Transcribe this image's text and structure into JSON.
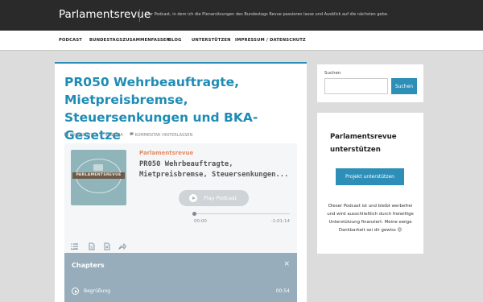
{
  "site": {
    "title": "Parlamentsrevue",
    "description": "Der Podcast, in dem ich die Plenarsitzungen des Bundestags Revue passieren lasse und Ausblick auf die nächsten gebe."
  },
  "nav": {
    "items": [
      {
        "label": "PODCAST"
      },
      {
        "label": "BUNDESTAGSZUSAMMENFASSER"
      },
      {
        "label": "BLOG"
      },
      {
        "label": "UNTERSTÜTZEN"
      },
      {
        "label": "IMPRESSUM / DATENSCHUTZ"
      }
    ]
  },
  "post": {
    "title": "PR050 Wehrbeauftragte, Mietpreisbremse, Steuersenkungen und BKA-Gesetze",
    "date": "2025-06-09",
    "author": "SABRINA",
    "comment": "KOMMENTAR HINTERLASSEN"
  },
  "player": {
    "cover_text": "PARLAMENTSREVUE",
    "show": "Parlamentsrevue",
    "episode_title": "PR050 Wehrbeauftragte, Mietpreisbremse, Steuersenkungen...",
    "play_label": "Play Podcast",
    "time_current": "00:00",
    "time_remaining": "-1:01:14",
    "progress": 0,
    "chapters_title": "Chapters",
    "close_symbol": "×",
    "chapters": [
      {
        "title": "Begrüßung",
        "time": "00:54"
      },
      {
        "title": "",
        "time": ""
      }
    ]
  },
  "sidebar": {
    "search": {
      "label": "Suchen",
      "placeholder": "",
      "button": "Suchen"
    },
    "support": {
      "title": "Parlamentsrevue unterstützen",
      "button": "Projekt unterstützen",
      "text": "Dieser Podcast ist und bleibt werbefrei und wird ausschließlich durch freiwillige Unterstützung finanziert. Meine ewige Dankbarkeit sei dir gewiss 😊"
    }
  },
  "colors": {
    "accent": "#2d8fb8",
    "topbar": "#2a2a2a",
    "show_name": "#e68a62",
    "chapters_bg": "#97adbb"
  }
}
